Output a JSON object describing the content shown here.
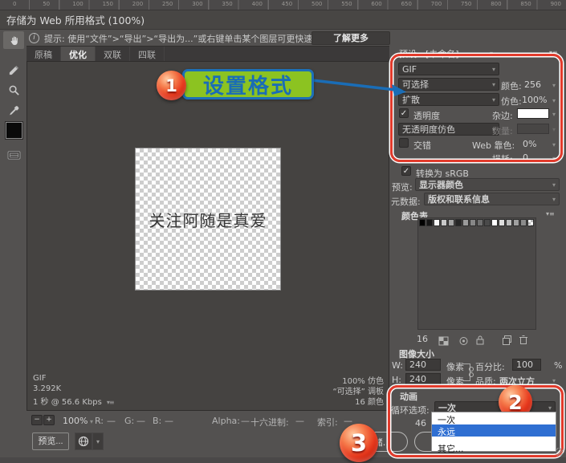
{
  "ruler": {
    "labels": [
      "0",
      "50",
      "100",
      "150",
      "200",
      "250",
      "300",
      "350",
      "400",
      "450",
      "500",
      "550",
      "600",
      "650",
      "700",
      "750",
      "800",
      "850",
      "900"
    ]
  },
  "window": {
    "title": "存储为 Web 所用格式 (100%)"
  },
  "info_bar": {
    "text": "提示: 使用“文件”>“导出”>“导出为...”或右键单击某个图层可更快速地导出资源",
    "learn_more": "了解更多",
    "info_glyph": "i"
  },
  "tabs": [
    {
      "label": "原稿",
      "active": false
    },
    {
      "label": "优化",
      "active": true
    },
    {
      "label": "双联",
      "active": false
    },
    {
      "label": "四联",
      "active": false
    }
  ],
  "toolbar_icons": [
    "hand-tool",
    "slice-select-tool",
    "zoom-tool",
    "eyedropper-tool",
    "eyedropper-color-swatch",
    "toggle-slices"
  ],
  "canvas": {
    "image_text": "关注阿随是真爱",
    "status_left": [
      "GIF",
      "3.292K",
      "1 秒 @ 56.6 Kbps"
    ],
    "status_right": [
      "100% 仿色",
      "“可选择” 调板",
      "16 颜色"
    ]
  },
  "annotations": {
    "step1": {
      "number": "1",
      "label": "设置格式"
    },
    "step2": {
      "number": "2"
    },
    "step3": {
      "number": "3"
    },
    "accent_red": "#e23b2c",
    "accent_green": "#8cc321",
    "accent_blue": "#1a6db6"
  },
  "preset": {
    "label": "预设:",
    "value": "[未命名]"
  },
  "settings": {
    "format": "GIF",
    "reduction": "可选择",
    "dither_method": "扩散",
    "transparency_label": "透明度",
    "transparency_checked": "✓",
    "trans_dither": "无透明度仿色",
    "interlaced_label": "交错",
    "colors_label": "颜色:",
    "colors_value": "256",
    "dither_label": "仿色:",
    "dither_value": "100%",
    "matte_label": "杂边:",
    "matte_color": "#ffffff",
    "amount_label": "数量:",
    "websnap_label": "Web 靠色:",
    "websnap_value": "0%",
    "lossy_label": "损耗:",
    "lossy_value": "0"
  },
  "convert_srgb": {
    "label": "转换为 sRGB",
    "checked": "✓"
  },
  "preview_row": {
    "label": "预览:",
    "value": "显示器颜色"
  },
  "metadata_row": {
    "label": "元数据:",
    "value": "版权和联系信息"
  },
  "color_table": {
    "header": "颜色表",
    "count": "16",
    "swatches": [
      "#000000",
      "#161616",
      "#f7f7f7",
      "#c9c9c9",
      "#a3a3a3",
      "#262626",
      "#9b9b9b",
      "#878787",
      "#6e6e6e",
      "#4a4a4a",
      "#ffffff",
      "#dedede",
      "#bcbcbc",
      "#a0a0a0",
      "#8b8b8b",
      "checker"
    ],
    "icons": [
      "map-transparency",
      "web-shift",
      "lock-color",
      "new-color",
      "delete-color"
    ]
  },
  "image_size": {
    "header": "图像大小",
    "w_label": "W:",
    "w_value": "240",
    "h_label": "H:",
    "h_value": "240",
    "unit": "像素",
    "percent_label": "百分比:",
    "percent_value": "100",
    "percent_unit": "%",
    "quality_label": "品质:",
    "quality_value": "两次立方"
  },
  "animation": {
    "header": "动画",
    "loop_label": "循环选项:",
    "loop_value": "一次",
    "frame_partial": "46",
    "menu": [
      {
        "label": "一次"
      },
      {
        "label": "永远"
      },
      {
        "label": "其它..."
      }
    ],
    "selected_item": "永远",
    "highlight_color": "#2f6fd2"
  },
  "statusbar": {
    "zoom": "100%",
    "items": [
      {
        "label": "R:",
        "value": "—"
      },
      {
        "label": "G:",
        "value": "—"
      },
      {
        "label": "B:",
        "value": "—"
      },
      {
        "label": "Alpha:",
        "value": "—"
      },
      {
        "label": "十六进制:",
        "value": "—"
      },
      {
        "label": "索引:",
        "value": "—"
      }
    ]
  },
  "buttons": {
    "preview": "预览...",
    "save": "存储..."
  }
}
